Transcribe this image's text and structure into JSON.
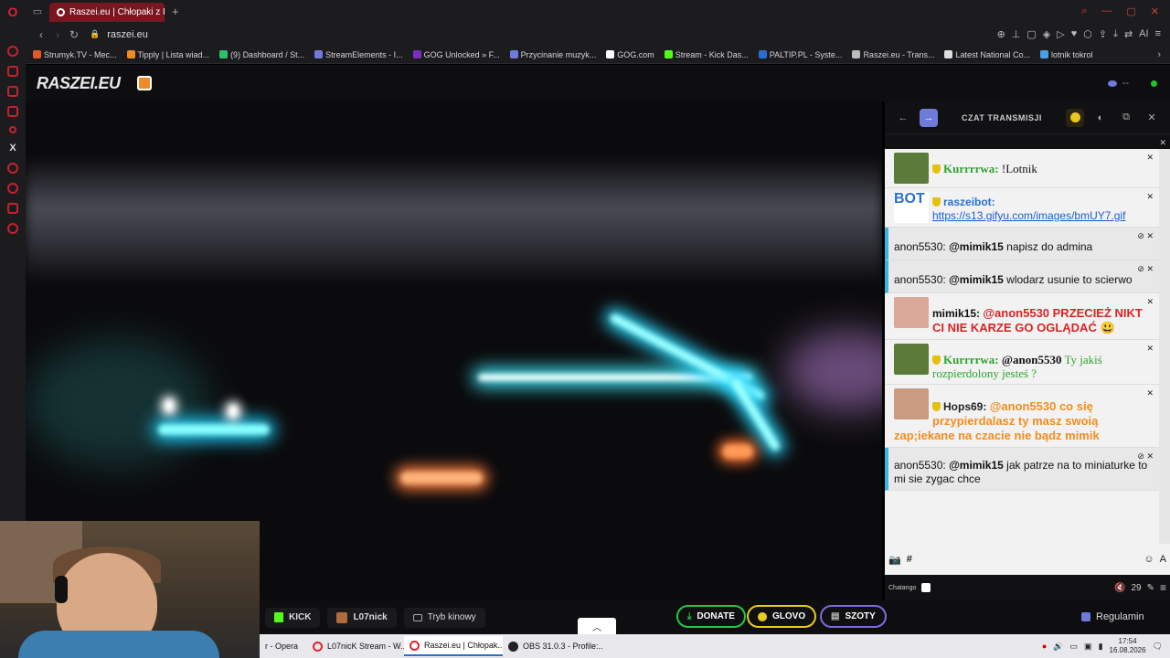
{
  "browser": {
    "active_tab_title": "Raszei.eu | Chłopaki z R",
    "url": "raszei.eu"
  },
  "bookmarks": [
    {
      "label": "Strumyk.TV - Mec...",
      "color": "#e15a2b"
    },
    {
      "label": "Tipply | Lista wiad...",
      "color": "#f08a24"
    },
    {
      "label": "(9) Dashboard / St...",
      "color": "#2fbf6a"
    },
    {
      "label": "StreamElements - I...",
      "color": "#6f7bd8"
    },
    {
      "label": "GOG Unlocked » F...",
      "color": "#7b2fbf"
    },
    {
      "label": "Przycinanie muzyk...",
      "color": "#6f7bd8"
    },
    {
      "label": "GOG.com",
      "color": "#ffffff"
    },
    {
      "label": "Stream - Kick Das...",
      "color": "#53fc18"
    },
    {
      "label": "PALTIP.PL - Syste...",
      "color": "#2a6ecf"
    },
    {
      "label": "Raszei.eu - Trans...",
      "color": "#bbbbbb"
    },
    {
      "label": "Latest National Co...",
      "color": "#dddddd"
    },
    {
      "label": "lotnik tokrol",
      "color": "#4aa0e6"
    }
  ],
  "site": {
    "logo": "RASZEI.EU",
    "viewer_count": "--"
  },
  "chat": {
    "title": "CZAT TRANSMISJI",
    "messages": [
      {
        "user": "Kurrrrwa:",
        "text": "!Lotnik"
      },
      {
        "user": "raszeibot:",
        "text": "https://s13.gifyu.com/images/bmUY7.gif",
        "avatar_label": "BOT"
      },
      {
        "user": "anon5530:",
        "mention": "@mimik15",
        "text": "napisz do admina"
      },
      {
        "user": "anon5530:",
        "mention": "@mimik15",
        "text": "wlodarz usunie to scierwo"
      },
      {
        "user": "mimik15:",
        "text": "@anon5530 PRZECIEŻ NIKT CI NIE KARZE GO OGLĄDAĆ 😃"
      },
      {
        "user": "Kurrrrwa:",
        "mention": "@anon5530",
        "text": "Ty jakiś rozpierdolony jesteś ?"
      },
      {
        "user": "Hops69:",
        "text": "@anon5530 co się przypierdalasz ty masz swoią zap;iekane na czacie nie bądz mimik"
      },
      {
        "user": "anon5530:",
        "mention": "@mimik15",
        "text": "jak patrze na to miniaturke to mi sie zygac chce"
      }
    ],
    "footer_brand": "Chatango",
    "user_count": "29"
  },
  "bottom_bar": {
    "kick": "KICK",
    "lotnick": "L07nick",
    "cinema": "Tryb kinowy",
    "donate": "DONATE",
    "glovo": "GLOVO",
    "szoty": "SZOTY",
    "rules": "Regulamin"
  },
  "taskbar": {
    "items": [
      "r - Opera",
      "L07nicK Stream - W...",
      "Raszei.eu | Chłopak...",
      "OBS 31.0.3 - Profile:..."
    ],
    "time": "17:54",
    "date": "16.08.2026"
  }
}
